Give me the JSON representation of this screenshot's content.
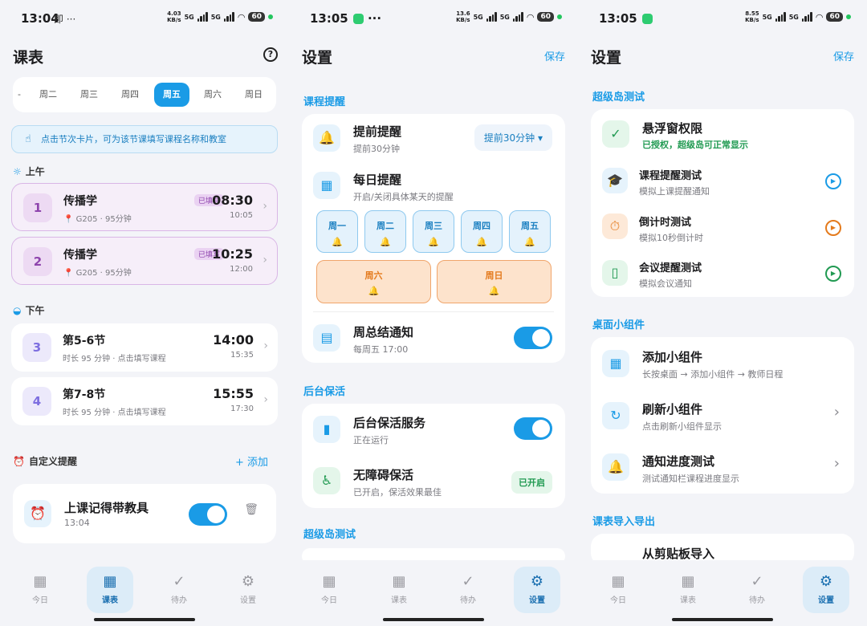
{
  "colors": {
    "accent": "#1a9be6",
    "lesson_filled": "#8e44ad",
    "weekend": "#e47a1c",
    "green": "#219a52"
  },
  "p1": {
    "status": {
      "time": "13:04",
      "extra": "即 ···",
      "speed1": "4.03",
      "speed2": "KB/s",
      "sig": "5G",
      "batt": "60"
    },
    "title": "课表",
    "help_icon": "question-circle-icon",
    "days": [
      "-",
      "周二",
      "周三",
      "周四",
      "周五",
      "周六",
      "周日"
    ],
    "selected_day": "周五",
    "tip": "点击节次卡片，可为该节课填写课程名称和教室",
    "morning": "上午",
    "afternoon": "下午",
    "lessons": [
      {
        "num": "1",
        "name": "传播学",
        "sub": "📍 G205 · 95分钟",
        "badge": "已填写",
        "start": "08:30",
        "end": "10:05"
      },
      {
        "num": "2",
        "name": "传播学",
        "sub": "📍 G205 · 95分钟",
        "badge": "已填写",
        "start": "10:25",
        "end": "12:00"
      },
      {
        "num": "3",
        "name": "第5-6节",
        "sub": "时长 95 分钟 · 点击填写课程",
        "start": "14:00",
        "end": "15:35"
      },
      {
        "num": "4",
        "name": "第7-8节",
        "sub": "时长 95 分钟 · 点击填写课程",
        "start": "15:55",
        "end": "17:30"
      }
    ],
    "custom_title": "自定义提醒",
    "add_label": "+ 添加",
    "reminder": {
      "title": "上课记得带教具",
      "time": "13:04",
      "enabled": true
    }
  },
  "p2": {
    "status": {
      "time": "13:05",
      "speed1": "13.6",
      "speed2": "KB/s",
      "sig": "5G",
      "batt": "60"
    },
    "title": "设置",
    "save": "保存",
    "sec_course": "课程提醒",
    "advance": {
      "title": "提前提醒",
      "sub": "提前30分钟",
      "select": "提前30分钟"
    },
    "daily": {
      "title": "每日提醒",
      "sub": "开启/关闭具体某天的提醒"
    },
    "weekdays": [
      "周一",
      "周二",
      "周三",
      "周四",
      "周五"
    ],
    "weekend": [
      "周六",
      "周日"
    ],
    "weekly": {
      "title": "周总结通知",
      "sub": "每周五 17:00",
      "enabled": true
    },
    "sec_keep": "后台保活",
    "keep": {
      "title": "后台保活服务",
      "sub": "正在运行",
      "enabled": true
    },
    "access": {
      "title": "无障碍保活",
      "sub": "已开启，保活效果最佳",
      "badge": "已开启"
    },
    "sec_island": "超级岛测试"
  },
  "p3": {
    "status": {
      "time": "13:05",
      "speed1": "8.55",
      "speed2": "KB/s",
      "sig": "5G",
      "batt": "60"
    },
    "title": "设置",
    "save": "保存",
    "sec_island": "超级岛测试",
    "float": {
      "title": "悬浮窗权限",
      "sub": "已授权，超级岛可正常显示"
    },
    "tests": [
      {
        "title": "课程提醒测试",
        "sub": "模拟上课提醒通知",
        "color": "#1a9be6",
        "icon": "graduation-cap-icon"
      },
      {
        "title": "倒计时测试",
        "sub": "模拟10秒倒计时",
        "color": "#e47a1c",
        "icon": "timer-icon"
      },
      {
        "title": "会议提醒测试",
        "sub": "模拟会议通知",
        "color": "#219a52",
        "icon": "door-icon"
      }
    ],
    "sec_widget": "桌面小组件",
    "widget_add": {
      "title": "添加小组件",
      "sub": "长按桌面 → 添加小组件 → 教师日程"
    },
    "widget_refresh": {
      "title": "刷新小组件",
      "sub": "点击刷新小组件显示"
    },
    "widget_notify": {
      "title": "通知进度测试",
      "sub": "测试通知栏课程进度显示"
    },
    "sec_import": "课表导入导出",
    "import_partial": "从剪贴板导入"
  },
  "nav": [
    "今日",
    "课表",
    "待办",
    "设置"
  ]
}
